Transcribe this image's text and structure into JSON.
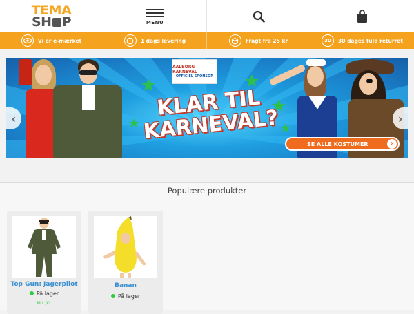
{
  "header": {
    "logo_top": "TEMA",
    "logo_bottom_left": "SH",
    "logo_bottom_right": "P",
    "menu_label": "MENU",
    "icons": [
      "search-icon",
      "shopping-bag-icon",
      "menu-icon"
    ]
  },
  "benefits": [
    {
      "icon": "eye-icon",
      "text": "Vi er e-mærket"
    },
    {
      "icon": "clock-icon",
      "text": "1 dags levering"
    },
    {
      "icon": "box-icon",
      "text": "Fragt fra 25 kr"
    },
    {
      "icon_text": "30",
      "icon": "return-30-icon",
      "text": "30 dages fuld returret"
    }
  ],
  "banner": {
    "sponsor_logo": "AALBORG KARNEVAL",
    "sponsor_text": "OFFICIEL SPONSOR",
    "headline_line1": "KLAR TIL",
    "headline_line2": "KARNEVAL?",
    "cta_label": "SE ALLE KOSTUMER",
    "prev_label": "‹",
    "next_label": "›"
  },
  "popular": {
    "title": "Populære produkter",
    "products": [
      {
        "name": "Top Gun: Jagerpilot",
        "stock": "På lager",
        "sizes": "M,L,XL"
      },
      {
        "name": "Banan",
        "stock": "På lager",
        "sizes": ""
      }
    ]
  },
  "colors": {
    "accent": "#f5a31e",
    "link": "#3a8fd0",
    "in_stock": "#2ecc40",
    "cta": "#ef6c1e"
  }
}
